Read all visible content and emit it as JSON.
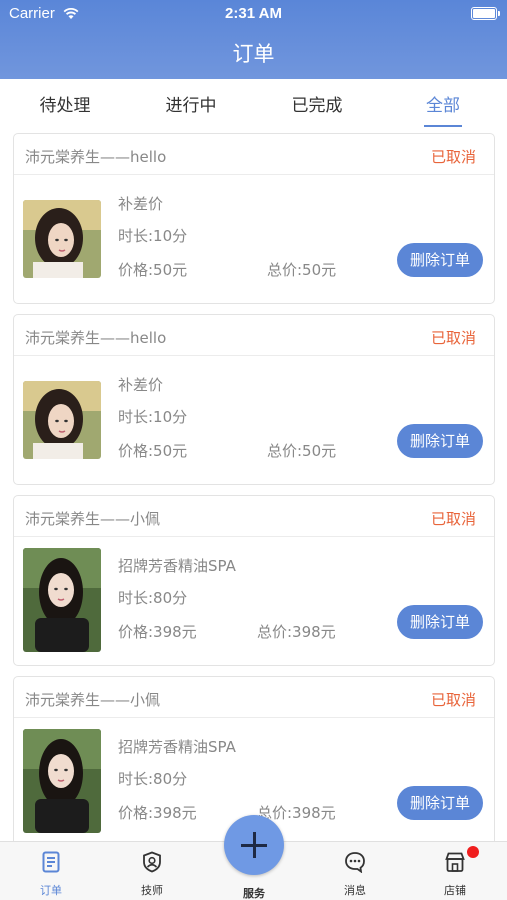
{
  "status_bar": {
    "carrier": "Carrier",
    "time": "2:31 AM"
  },
  "header": {
    "title": "订单"
  },
  "tabs": [
    {
      "label": "待处理",
      "active": false
    },
    {
      "label": "进行中",
      "active": false
    },
    {
      "label": "已完成",
      "active": false
    },
    {
      "label": "全部",
      "active": true
    }
  ],
  "orders": [
    {
      "shop": "沛元棠养生——hello",
      "status": "已取消",
      "service": "补差价",
      "duration": "时长:10分",
      "price": "价格:50元",
      "total": "总价:50元",
      "delete_label": "删除订单"
    },
    {
      "shop": "沛元棠养生——hello",
      "status": "已取消",
      "service": "补差价",
      "duration": "时长:10分",
      "price": "价格:50元",
      "total": "总价:50元",
      "delete_label": "删除订单"
    },
    {
      "shop": "沛元棠养生——小佩",
      "status": "已取消",
      "service": "招牌芳香精油SPA",
      "duration": "时长:80分",
      "price": "价格:398元",
      "total": "总价:398元",
      "delete_label": "删除订单"
    },
    {
      "shop": "沛元棠养生——小佩",
      "status": "已取消",
      "service": "招牌芳香精油SPA",
      "duration": "时长:80分",
      "price": "价格:398元",
      "total": "总价:398元",
      "delete_label": "删除订单"
    }
  ],
  "tabbar": {
    "items": [
      {
        "label": "订单",
        "icon": "order-document-icon",
        "active": true
      },
      {
        "label": "技师",
        "icon": "technician-shield-icon",
        "active": false
      },
      {
        "label": "服务",
        "icon": "plus-icon",
        "active": false
      },
      {
        "label": "消息",
        "icon": "message-bubble-icon",
        "active": false
      },
      {
        "label": "店铺",
        "icon": "store-icon",
        "active": false
      }
    ]
  },
  "colors": {
    "accent": "#5b86d6",
    "header": "#6790db",
    "cancelled": "#e8643a",
    "badge": "#f01e1e"
  }
}
